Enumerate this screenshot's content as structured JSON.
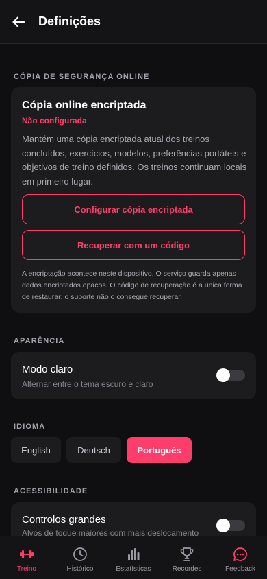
{
  "header": {
    "title": "Definições",
    "back_icon": "arrow-left-icon"
  },
  "backup": {
    "section_label": "CÓPIA DE SEGURANÇA ONLINE",
    "title": "Cópia online encriptada",
    "status": "Não configurada",
    "description": "Mantém uma cópia encriptada atual dos treinos concluídos, exercícios, modelos, preferências portáteis e objetivos de treino definidos. Os treinos continuam locais em primeiro lugar.",
    "configure_label": "Configurar cópia encriptada",
    "recover_label": "Recuperar com um código",
    "note": "A encriptação acontece neste dispositivo. O serviço guarda apenas dados encriptados opacos. O código de recuperação é a única forma de restaurar; o suporte não o consegue recuperar."
  },
  "appearance": {
    "section_label": "APARÊNCIA",
    "light_mode_title": "Modo claro",
    "light_mode_subtitle": "Alternar entre o tema escuro e claro",
    "light_mode_on": false
  },
  "language": {
    "section_label": "IDIOMA",
    "options": [
      "English",
      "Deutsch",
      "Português"
    ],
    "selected": "Português"
  },
  "accessibility": {
    "section_label": "ACESSIBILIDADE",
    "large_controls_title": "Controlos grandes",
    "large_controls_subtitle": "Alvos de toque maiores com mais deslocamento",
    "large_controls_on": false
  },
  "tabs": [
    {
      "label": "Treino",
      "icon": "dumbbell-icon",
      "active": true
    },
    {
      "label": "Histórico",
      "icon": "clock-icon",
      "active": false
    },
    {
      "label": "Estatísticas",
      "icon": "bar-chart-icon",
      "active": false
    },
    {
      "label": "Recordes",
      "icon": "trophy-icon",
      "active": false
    },
    {
      "label": "Feedback",
      "icon": "chat-bubble-icon",
      "active": false
    }
  ],
  "colors": {
    "accent": "#ff3d6b",
    "background": "#0f0f11",
    "card": "#1c1c1f",
    "muted_text": "#a9a9b1"
  }
}
